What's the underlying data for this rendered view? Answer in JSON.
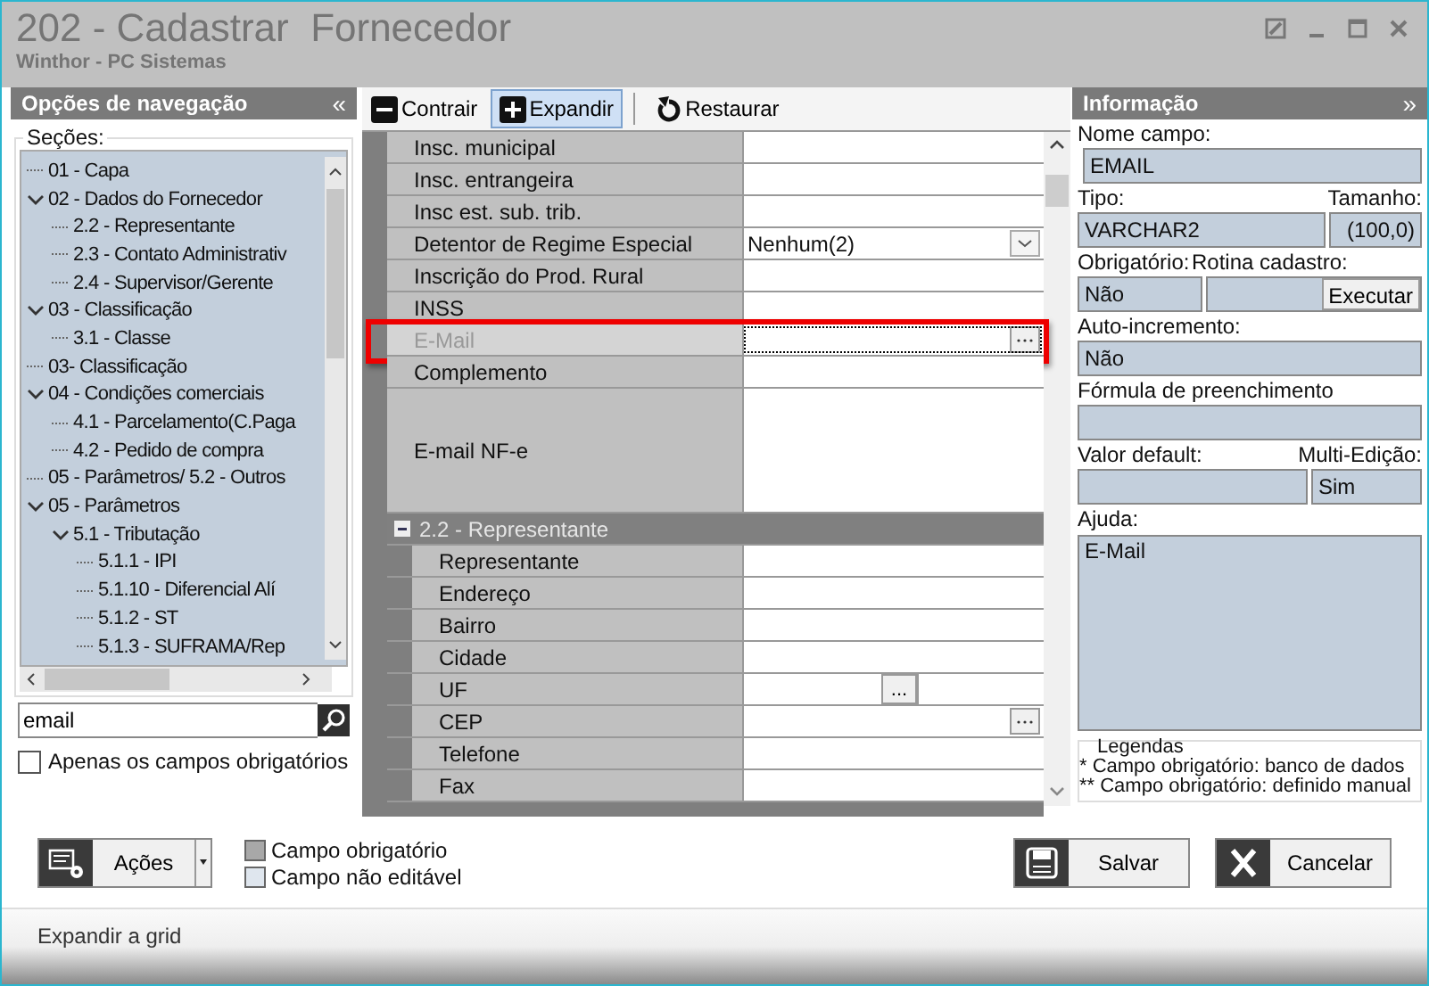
{
  "window": {
    "title": "202 - Cadastrar  Fornecedor",
    "subtitle": "Winthor - PC Sistemas"
  },
  "navigation": {
    "title": "Opções de navegação",
    "collapse": "«",
    "sections_label": "Seções:",
    "tree": [
      {
        "label": "01 - Capa"
      },
      {
        "label": "02 - Dados do Fornecedor",
        "expanded": true,
        "children": [
          {
            "label": "2.2 - Representante"
          },
          {
            "label": "2.3 - Contato Administrativ"
          },
          {
            "label": "2.4 - Supervisor/Gerente"
          }
        ]
      },
      {
        "label": "03 - Classificação",
        "expanded": true,
        "children": [
          {
            "label": "3.1 - Classe"
          }
        ]
      },
      {
        "label": "03- Classificação"
      },
      {
        "label": "04 - Condições comerciais",
        "expanded": true,
        "children": [
          {
            "label": "4.1 - Parcelamento(C.Paga"
          },
          {
            "label": "4.2 - Pedido de compra"
          }
        ]
      },
      {
        "label": "05 - Parâmetros/ 5.2 - Outros"
      },
      {
        "label": "05 - Parâmetros",
        "expanded": true,
        "children": [
          {
            "label": "5.1 - Tributação",
            "expanded": true,
            "children": [
              {
                "label": "5.1.1 - IPI"
              },
              {
                "label": "5.1.10 - Diferencial Alí"
              },
              {
                "label": "5.1.2 - ST"
              },
              {
                "label": "5.1.3 - SUFRAMA/Rep"
              }
            ]
          }
        ]
      }
    ],
    "search": {
      "value": "email"
    },
    "only_required": {
      "label": "Apenas os campos obrigatórios",
      "checked": false
    }
  },
  "toolbar": [
    {
      "label": "Contrair",
      "kind": "minus",
      "selected": false
    },
    {
      "label": "Expandir",
      "kind": "plus",
      "selected": true
    },
    {
      "label": "Restaurar",
      "kind": "restore",
      "selected": false
    }
  ],
  "grid": {
    "rows": [
      {
        "kind": "text",
        "label": "Insc. municipal"
      },
      {
        "kind": "text",
        "label": "Insc. entrangeira"
      },
      {
        "kind": "text",
        "label": "Insc est. sub. trib."
      },
      {
        "kind": "dropdown",
        "label": "Detentor de Regime Especial",
        "value": "Nenhum(2)"
      },
      {
        "kind": "text",
        "label": "Inscrição do Prod. Rural"
      },
      {
        "kind": "text",
        "label": "INSS"
      },
      {
        "kind": "lookup",
        "label": "E-Mail",
        "disabled": true,
        "highlighted": true
      },
      {
        "kind": "text",
        "label": "Complemento"
      },
      {
        "kind": "memo",
        "label": "E-mail NF-e"
      },
      {
        "kind": "group",
        "label": "2.2 - Representante",
        "expanded": true,
        "children": [
          {
            "kind": "text",
            "label": "Representante"
          },
          {
            "kind": "text",
            "label": "Endereço"
          },
          {
            "kind": "text",
            "label": "Bairro"
          },
          {
            "kind": "text",
            "label": "Cidade"
          },
          {
            "kind": "split",
            "label": "UF",
            "button": "..."
          },
          {
            "kind": "lookup",
            "label": "CEP"
          },
          {
            "kind": "text",
            "label": "Telefone"
          },
          {
            "kind": "text",
            "label": "Fax"
          }
        ]
      }
    ]
  },
  "info": {
    "title": "Informação",
    "expand": "»",
    "field_name": {
      "label": "Nome campo:",
      "value": "EMAIL"
    },
    "type": {
      "label": "Tipo:",
      "value": "VARCHAR2"
    },
    "size": {
      "label": "Tamanho:",
      "value": "(100,0)"
    },
    "required": {
      "label": "Obrigatório:",
      "value": "Não"
    },
    "routine": {
      "label": "Rotina cadastro:",
      "button": "Executar"
    },
    "auto_increment": {
      "label": "Auto-incremento:",
      "value": "Não"
    },
    "formula": {
      "label": "Fórmula de preenchimento"
    },
    "default": {
      "label": "Valor default:"
    },
    "multi_edit": {
      "label": "Multi-Edição:",
      "value": "Sim"
    },
    "help": {
      "label": "Ajuda:",
      "value": "E-Mail"
    },
    "legend": {
      "title": "Legendas",
      "lines": [
        "* Campo obrigatório: banco de dados",
        "** Campo obrigatório: definido manual"
      ]
    }
  },
  "actions_button": {
    "label": "Ações"
  },
  "legend": [
    {
      "label": "Campo obrigatório",
      "color": "#a8a8a8"
    },
    {
      "label": "Campo não editável",
      "color": "#dfe6ee"
    }
  ],
  "buttons": [
    {
      "label": "Salvar",
      "kind": "save"
    },
    {
      "label": "Cancelar",
      "kind": "cancel"
    }
  ],
  "status_bar": {
    "text": "Expandir a grid"
  }
}
